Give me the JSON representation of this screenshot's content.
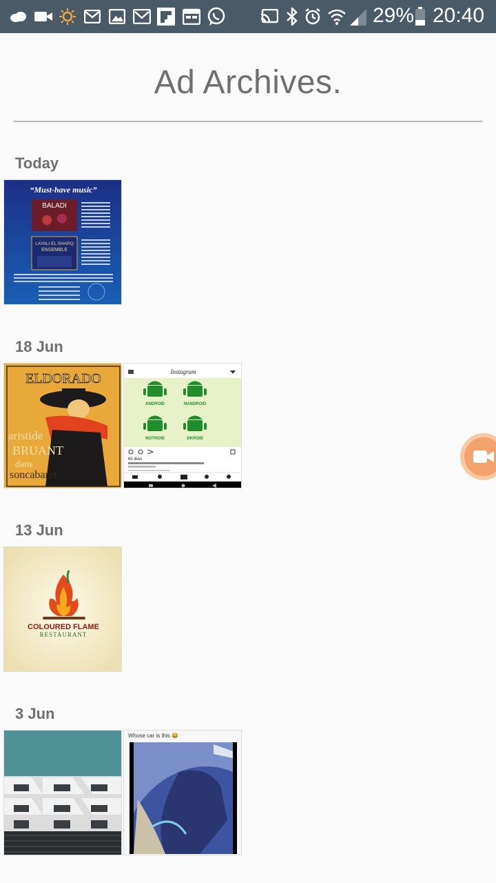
{
  "status_bar": {
    "battery_percent": "29%",
    "time": "20:40",
    "icons": [
      "cloud-icon",
      "video-icon",
      "sun-icon",
      "gmail-icon",
      "gallery-icon",
      "gmail-icon",
      "flipboard-icon",
      "calendar-icon",
      "whatsapp-icon",
      "cast-icon",
      "bluetooth-icon",
      "alarm-icon",
      "wifi-icon",
      "signal-icon",
      "battery-icon"
    ]
  },
  "page": {
    "title": "Ad Archives."
  },
  "sections": [
    {
      "label": "Today",
      "items": [
        "Must-have music ad"
      ]
    },
    {
      "label": "18 Jun",
      "items": [
        "Eldorado poster",
        "Instagram android post"
      ]
    },
    {
      "label": "13 Jun",
      "items": [
        "Coloured Flame Restaurant logo"
      ]
    },
    {
      "label": "3 Jun",
      "items": [
        "Building photo",
        "Whose car is this screenshot"
      ]
    }
  ],
  "thumbs": {
    "music": {
      "headline": "“Must-have music”",
      "album1": "BALADI",
      "album2_l1": "LAYALI EL SHARQ",
      "album2_l2": "ENSEMBLE"
    },
    "eldorado": {
      "top": "ELDORADO",
      "l1": "aristide",
      "l2": "BRUANT",
      "l3": "dans",
      "l4": "soncabaret"
    },
    "instagram": {
      "app": "Instagram",
      "labels": [
        "ANDROID",
        "NANDROID",
        "NOTROID",
        "OKROID"
      ],
      "likes": "65 likes"
    },
    "flame": {
      "name": "COLOURED FLAME",
      "sub": "RESTAURANT"
    },
    "car": {
      "caption": "Whose car is this 😂"
    }
  },
  "colors": {
    "status_bar": "#4a5a66",
    "title_text": "#6f6f6f",
    "background": "#fafafa",
    "fab": "#f3a26b"
  }
}
